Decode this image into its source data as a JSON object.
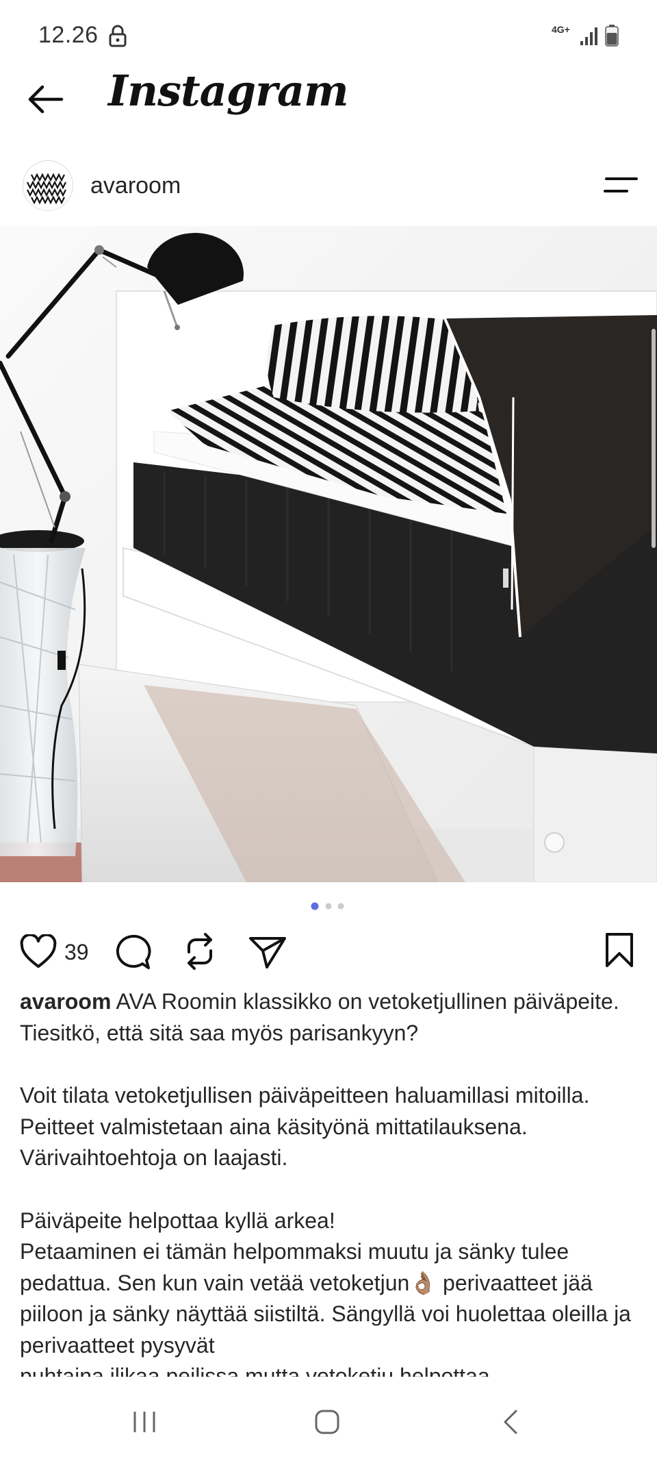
{
  "status_bar": {
    "time": "12.26",
    "network": "4G+",
    "icons": [
      "lock-icon",
      "signal-icon",
      "battery-icon"
    ]
  },
  "app_bar": {
    "title": "Instagram",
    "back_icon": "back-arrow-icon"
  },
  "post": {
    "username": "avaroom",
    "avatar_icon": "avaroom-logo",
    "menu_icon": "hamburger-menu-icon",
    "carousel": {
      "current": 1,
      "total": 3,
      "active_color": "#5b6ee1",
      "inactive_color": "#cccccc"
    },
    "like_count": "39",
    "action_icons": [
      "heart-icon",
      "comment-icon",
      "repost-icon",
      "share-icon",
      "bookmark-icon"
    ],
    "caption": {
      "user": "avaroom",
      "line1": " AVA Roomin klassikko on vetoketjullinen päiväpeite. Tiesitkö, että sitä saa myös parisankyyn?",
      "para2": "Voit tilata vetoketjullisen päiväpeitteen haluamillasi mitoilla. Peitteet valmistetaan aina käsityönä mittatilauksena. Värivaihtoehtoja on laajasti.",
      "para3_line1": "Päiväpeite helpottaa kyllä arkea!",
      "para3_rest": "Petaaminen ei tämän helpommaksi muutu ja sänky tulee pedattua. Sen kun vain vetää vetoketjun👌🏽 perivaatteet jää piiloon ja sänky näyttää siistiltä. Sängyllä voi huolettaa oleilla ja perivaatteet pysyvät",
      "para3_cut": "puhtaina ilikaa peilissa mutta vetoketju helpottaa"
    }
  },
  "nav_bar": {
    "icons": [
      "recents-icon",
      "home-icon",
      "back-icon"
    ]
  },
  "colors": {
    "text": "#262626",
    "background": "#ffffff",
    "accent_dot": "#5b6ee1"
  }
}
